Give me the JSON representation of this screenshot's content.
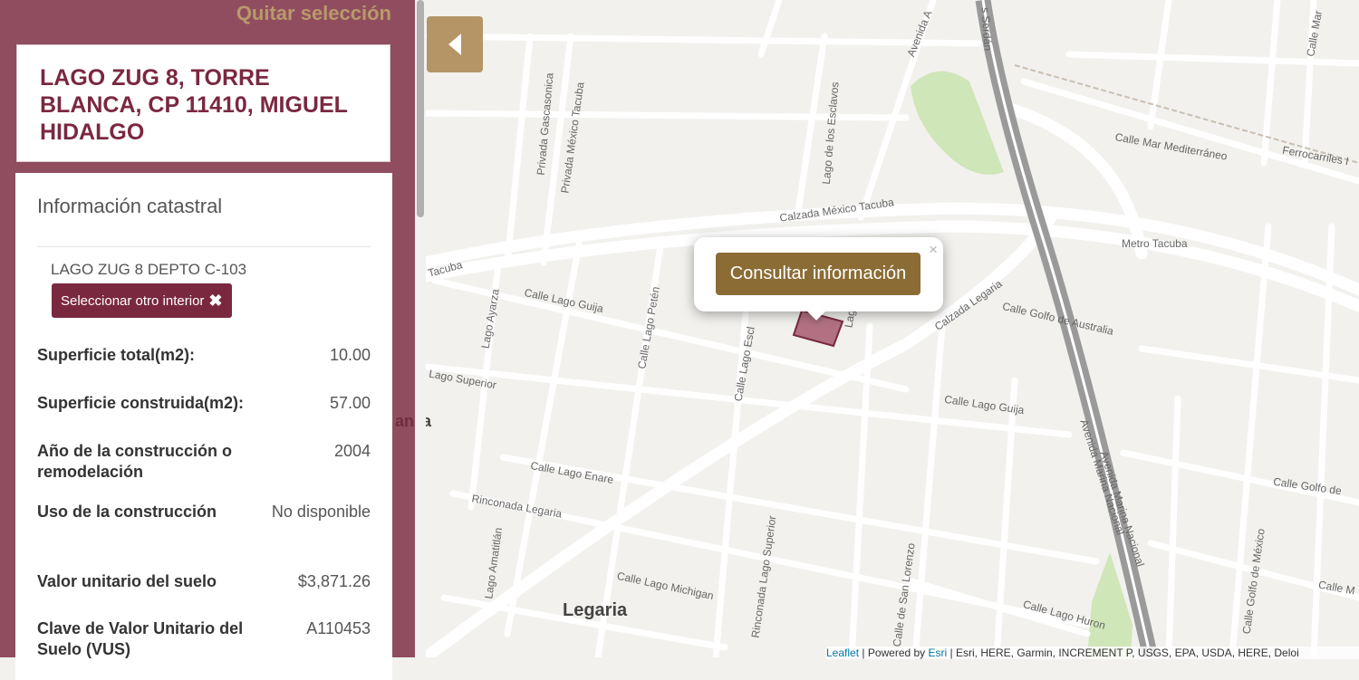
{
  "sidebar": {
    "clear_selection": "Quitar selección",
    "address": "LAGO ZUG 8, TORRE BLANCA, CP 11410, MIGUEL HIDALGO",
    "info_heading": "Información catastral",
    "interior": "LAGO ZUG 8 DEPTO C-103",
    "select_other_label": "Seleccionar otro interior",
    "rows": [
      {
        "label": "Superficie total(m2):",
        "value": "10.00"
      },
      {
        "label": "Superficie construida(m2):",
        "value": "57.00"
      },
      {
        "label": "Año de la construcción o remodelación",
        "value": "2004"
      },
      {
        "label": "Uso de la construcción",
        "value": "No disponible"
      },
      {
        "label": "Valor unitario del suelo",
        "value": "$3,871.26"
      },
      {
        "label": "Clave de Valor Unitario del Suelo (VUS)",
        "value": "A110453"
      }
    ]
  },
  "popup": {
    "button_label": "Consultar información",
    "close_glyph": "×"
  },
  "map": {
    "attribution": {
      "leaflet": "Leaflet",
      "powered_by": " | Powered by ",
      "esri": "Esri",
      "sources": " | Esri, HERE, Garmin, INCREMENT P, USGS, EPA, USDA, HERE, Deloi"
    },
    "labels": {
      "privada_gascasonica": "Privada Gascasonica",
      "privada_mexico_tacuba": "Privada México Tacuba",
      "lago_esclavos": "Lago de los Esclavos",
      "calzada_mexico_tacuba": "Calzada México Tacuba",
      "calle_mar_mediterraneo": "Calle Mar Mediterráneo",
      "ferrocarriles": "Ferrocarriles I",
      "metro_tacuba": "Metro Tacuba",
      "calle_lago_guija": "Calle Lago Guija",
      "lago_ayarza": "Lago Ayarza",
      "calle_lago_peten": "Calle Lago Petén",
      "calle_lago_escl": "Calle Lago Escl",
      "calzada_legaria": "Calzada Legaria",
      "calle_golfo_australia": "Calle Golfo de Australia",
      "lago_superior_w": "Lago Superior",
      "calle_lago_guija_e": "Calle Lago Guija",
      "avenida_marina_nacional": "Avenida Marina Nacional",
      "avenida_marina_nacional_2": "Avenida Marina Nacional",
      "calle_lago_enare": "Calle Lago Enare",
      "rinconada_legaria": "Rinconada Legaria",
      "calle_golfo_de": "Calle Golfo de",
      "lago_amatitlan": "Lago Amatitlán",
      "calle_lago_michigan": "Calle Lago Michigan",
      "rinconada_lago_superior": "Rinconada Lago Superior",
      "calle_san_lorenzo": "Calle de San Lorenzo",
      "calle_lago_huron": "Calle Lago Huron",
      "calle_golfo_mexico": "Calle Golfo de México",
      "calle_m": "Calle M",
      "legaria": "Legaria",
      "serdan": "s Serdán",
      "avenida_n": "Avenida A",
      "calle_mar": "Calle Mar",
      "tacuba_w": "Tacuba",
      "lag": "Lag",
      "anza": "anza"
    }
  },
  "colors": {
    "sidebar": "#7a2840",
    "accent_gold": "#b59466",
    "button_brown": "#8b6c35",
    "park": "#cfe6b8",
    "highway": "#9a9a9a"
  }
}
